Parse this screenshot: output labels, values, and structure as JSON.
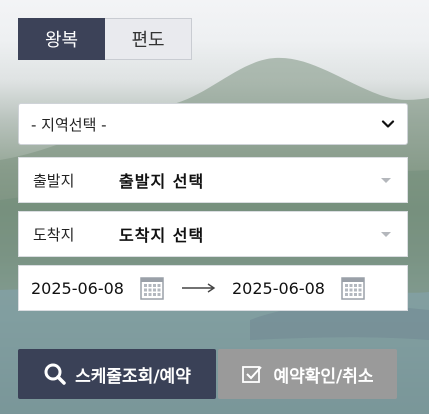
{
  "trip_type": {
    "round_trip_label": "왕복",
    "one_way_label": "편도",
    "selected": "왕복"
  },
  "region": {
    "selected_value": "- 지역선택 -"
  },
  "departure": {
    "label": "출발지",
    "value": "출발지 선택"
  },
  "arrival": {
    "label": "도착지",
    "value": "도착지 선택"
  },
  "dates": {
    "start": "2025-06-08",
    "end": "2025-06-08"
  },
  "actions": {
    "schedule_label": "스케줄조회/예약",
    "confirm_label": "예약확인/취소"
  },
  "colors": {
    "primary": "#3c4258",
    "secondary_button": "#9a9a9a"
  },
  "icons": {
    "schedule": "search-icon",
    "confirm": "checkbox-icon",
    "date": "calendar-icon",
    "range": "arrow-right-icon",
    "select": "chevron-down-icon"
  }
}
